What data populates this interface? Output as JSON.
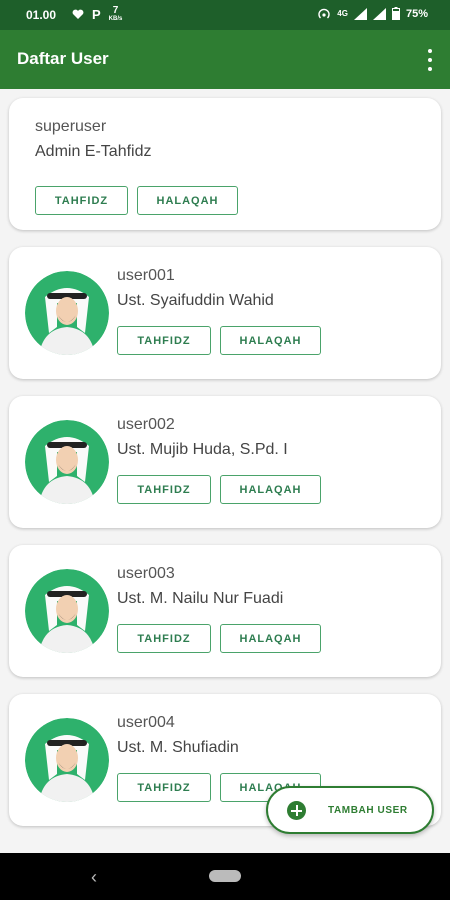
{
  "status_bar": {
    "time": "01.00",
    "icons": [
      "heart-icon",
      "parking-icon",
      "data-speed-icon",
      "hotspot-icon",
      "4g-icon",
      "signal-icon",
      "battery-icon"
    ],
    "speed_value": "7",
    "speed_unit": "KB/s",
    "network": "4G",
    "battery": "75%"
  },
  "app_bar": {
    "title": "Daftar User"
  },
  "users": [
    {
      "username": "superuser",
      "name": "Admin E-Tahfidz",
      "has_avatar": false,
      "button_tahfidz": "TAHFIDZ",
      "button_halaqah": "HALAQAH"
    },
    {
      "username": "user001",
      "name": "Ust. Syaifuddin Wahid",
      "has_avatar": true,
      "button_tahfidz": "TAHFIDZ",
      "button_halaqah": "HALAQAH"
    },
    {
      "username": "user002",
      "name": "Ust. Mujib Huda, S.Pd. I",
      "has_avatar": true,
      "button_tahfidz": "TAHFIDZ",
      "button_halaqah": "HALAQAH"
    },
    {
      "username": "user003",
      "name": "Ust. M. Nailu Nur Fuadi",
      "has_avatar": true,
      "button_tahfidz": "TAHFIDZ",
      "button_halaqah": "HALAQAH"
    },
    {
      "username": "user004",
      "name": "Ust. M. Shufiadin",
      "has_avatar": true,
      "button_tahfidz": "TAHFIDZ",
      "button_halaqah": "HALAQAH"
    }
  ],
  "fab": {
    "label": "TAMBAH USER"
  },
  "nav_bar": {
    "back_glyph": "‹"
  },
  "colors": {
    "primary": "#2e7d32",
    "status_bar": "#1e5f2a",
    "accent": "#4aa36a",
    "avatar_bg": "#2eb16c"
  }
}
